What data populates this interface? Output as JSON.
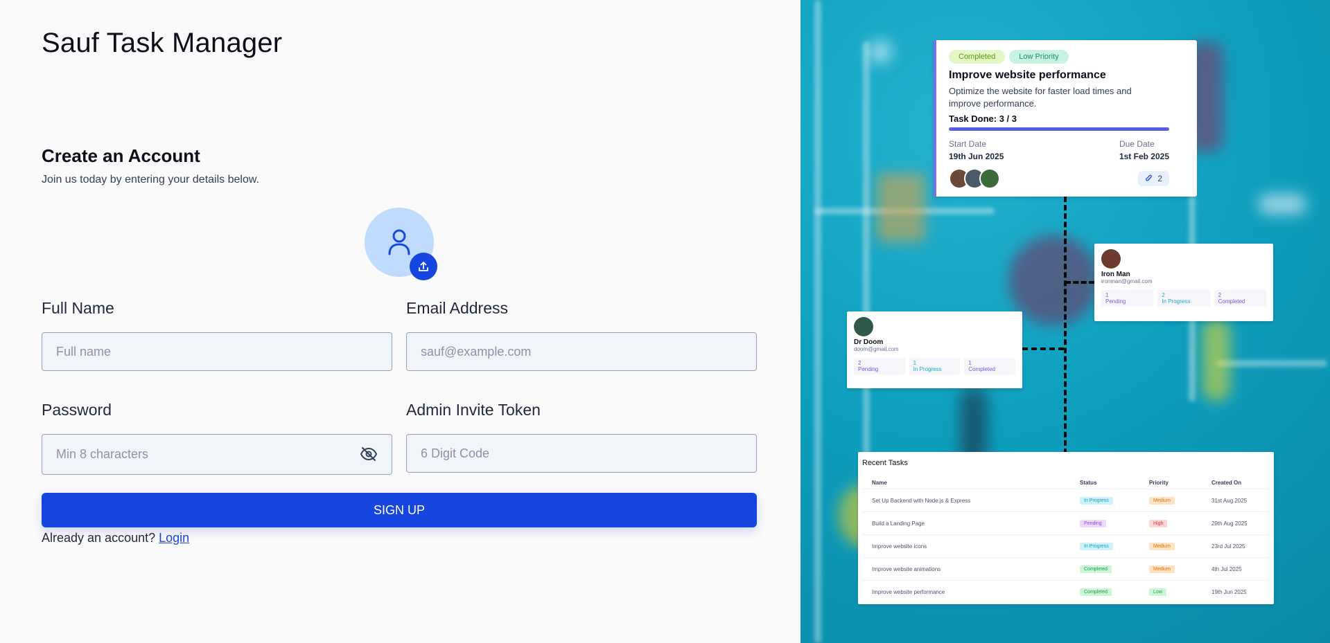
{
  "app": {
    "title": "Sauf Task Manager"
  },
  "form": {
    "heading": "Create an Account",
    "subheading": "Join us today by entering your details below.",
    "avatar_icon": "user-icon",
    "upload_icon": "upload-icon",
    "full_name": {
      "label": "Full Name",
      "placeholder": "Full name",
      "value": ""
    },
    "email": {
      "label": "Email Address",
      "placeholder": "sauf@example.com",
      "value": ""
    },
    "password": {
      "label": "Password",
      "placeholder": "Min 8 characters",
      "value": "",
      "toggle_icon": "eye-off-icon"
    },
    "admin_token": {
      "label": "Admin Invite Token",
      "placeholder": "6 Digit Code",
      "value": ""
    },
    "submit_label": "SIGN UP",
    "footer_text": "Already an account?",
    "login_label": "Login"
  },
  "colors": {
    "primary": "#1745e0",
    "avatar_bg": "#bfdbfe",
    "panel_bg": "#0f9fbf"
  },
  "task_card": {
    "status": "Completed",
    "priority": "Low Priority",
    "title": "Improve website performance",
    "description": "Optimize the website for faster load times and improve performance.",
    "task_done_label": "Task Done: 3 / 3",
    "progress": 1.0,
    "start_label": "Start Date",
    "start_value": "19th Jun 2025",
    "due_label": "Due Date",
    "due_value": "1st Feb 2025",
    "attachments": "2"
  },
  "users": [
    {
      "name": "Iron Man",
      "email": "ironman@gmail.com",
      "pending": "1",
      "pending_label": "Pending",
      "in_progress": "2",
      "in_progress_label": "In Progress",
      "completed": "2",
      "completed_label": "Completed"
    },
    {
      "name": "Dr Doom",
      "email": "doom@gmail.com",
      "pending": "2",
      "pending_label": "Pending",
      "in_progress": "1",
      "in_progress_label": "In Progress",
      "completed": "1",
      "completed_label": "Completed"
    }
  ],
  "recent_tasks": {
    "title": "Recent Tasks",
    "columns": [
      "Name",
      "Status",
      "Priority",
      "Created On"
    ],
    "rows": [
      {
        "name": "Set Up Backend with Node.js & Express",
        "status": "In Progress",
        "priority": "Medium",
        "created": "31st Aug 2025"
      },
      {
        "name": "Build a Landing Page",
        "status": "Pending",
        "priority": "High",
        "created": "29th Aug 2025"
      },
      {
        "name": "Improve website icons",
        "status": "In Progress",
        "priority": "Medium",
        "created": "23rd Jul 2025"
      },
      {
        "name": "Improve website animations",
        "status": "Completed",
        "priority": "Medium",
        "created": "4th Jul 2025"
      },
      {
        "name": "Improve website performance",
        "status": "Completed",
        "priority": "Low",
        "created": "19th Jun 2025"
      }
    ]
  }
}
